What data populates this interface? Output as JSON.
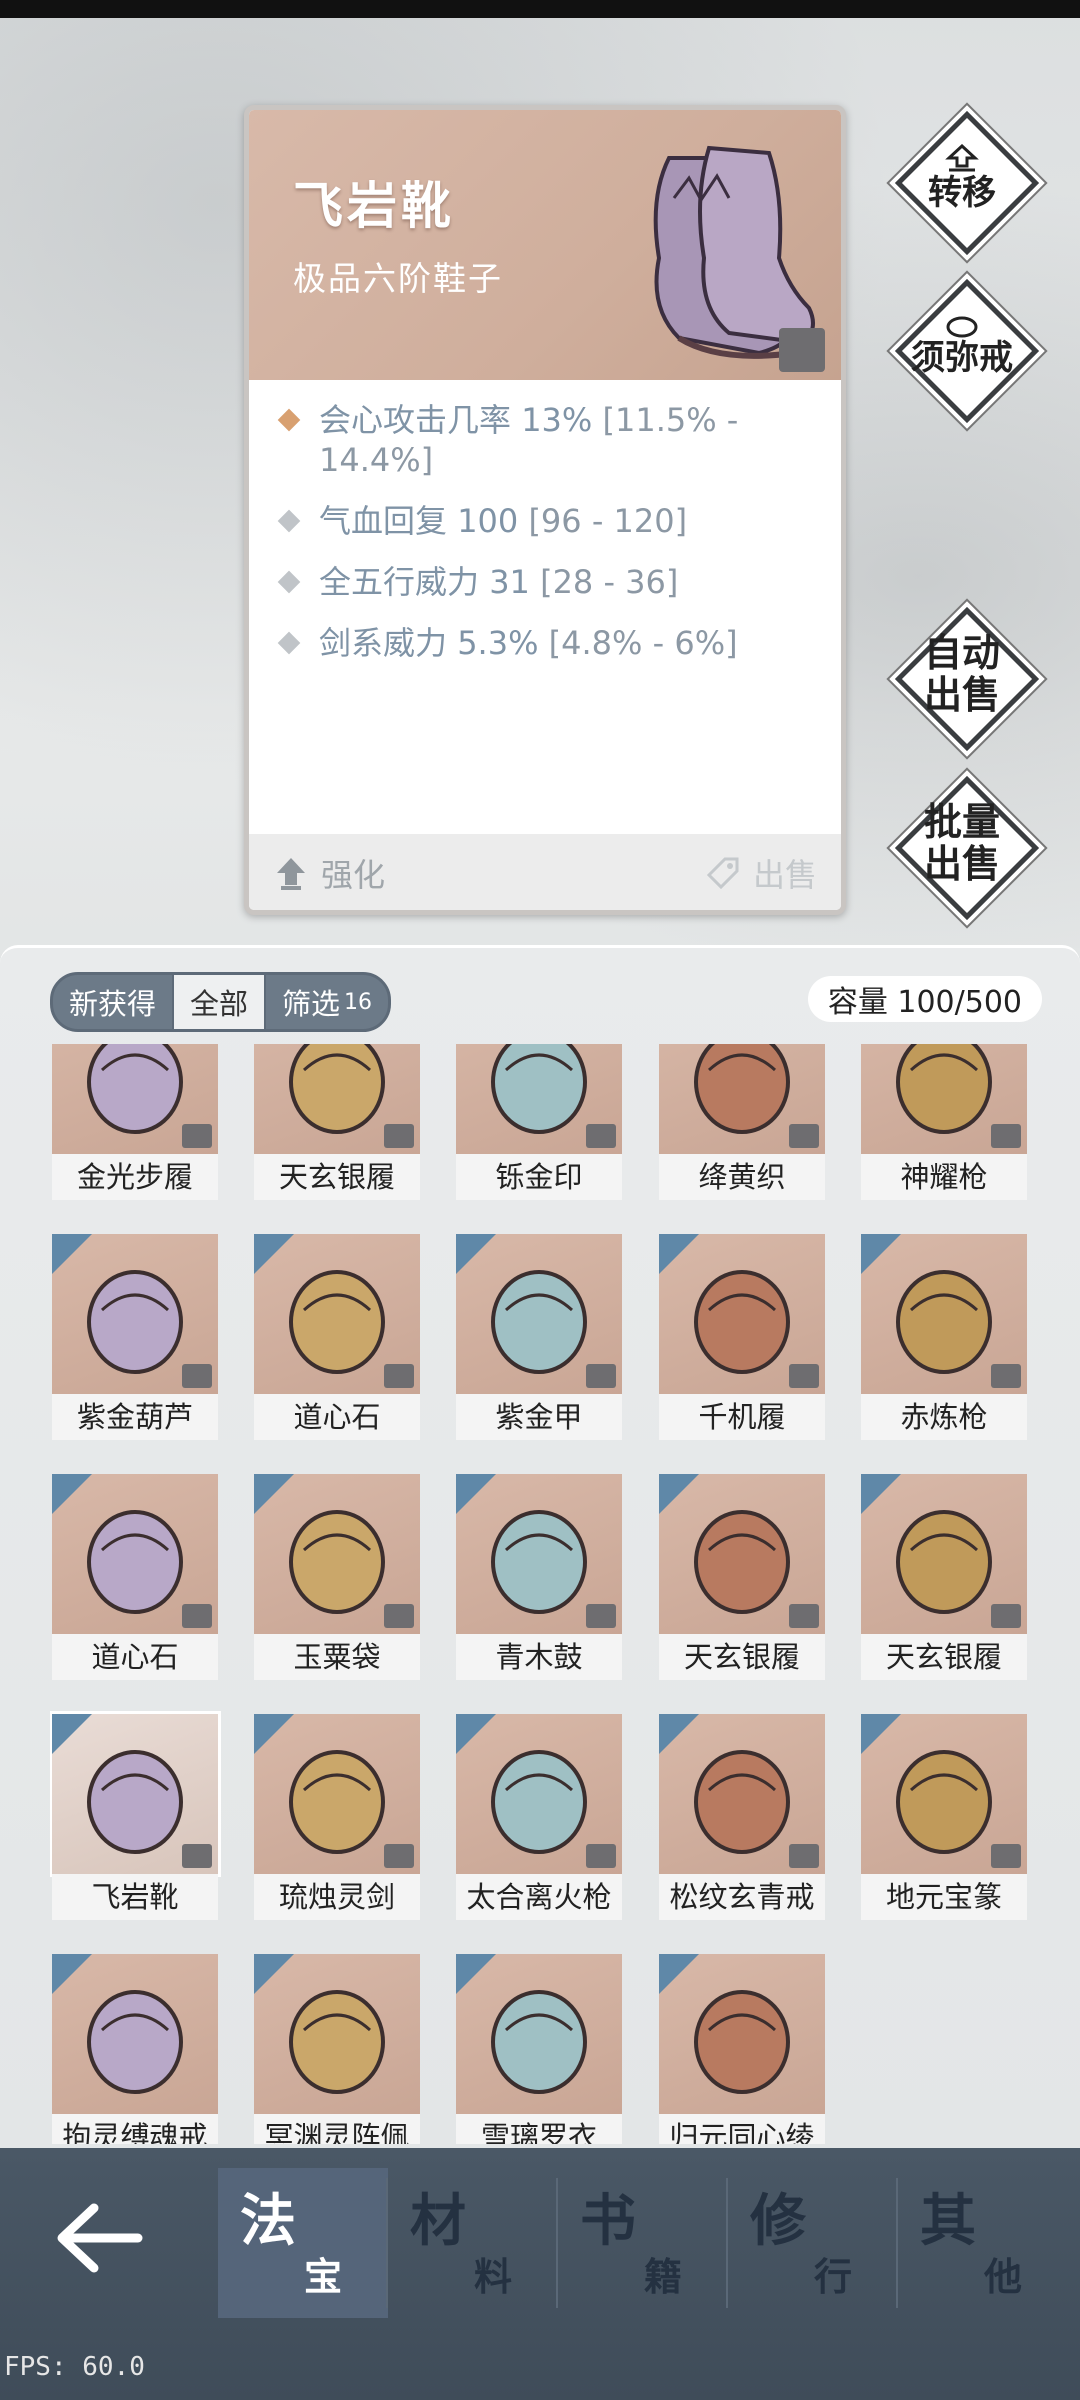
{
  "item": {
    "name": "飞岩靴",
    "grade": "极品六阶鞋子",
    "stats": [
      {
        "name": "会心攻击几率",
        "value": "13%",
        "range": "[11.5% - 14.4%]"
      },
      {
        "name": "气血回复",
        "value": "100",
        "range": "[96 - 120]"
      },
      {
        "name": "全五行威力",
        "value": "31",
        "range": "[28 - 36]"
      },
      {
        "name": "剑系威力",
        "value": "5.3%",
        "range": "[4.8% - 6%]"
      }
    ],
    "enhance_label": "强化",
    "sell_label": "出售"
  },
  "side_buttons": {
    "transfer": "转移",
    "ring": "须弥戒",
    "auto_sell_1": "自动",
    "auto_sell_2": "出售",
    "batch_sell_1": "批量",
    "batch_sell_2": "出售"
  },
  "inventory": {
    "tabs": [
      {
        "label": "新获得"
      },
      {
        "label": "全部"
      },
      {
        "label": "筛选",
        "badge": "16"
      }
    ],
    "capacity": "容量 100/500",
    "items": [
      "金光步履",
      "天玄银履",
      "铄金印",
      "绛黄织",
      "神耀枪",
      "紫金葫芦",
      "道心石",
      "紫金甲",
      "千机履",
      "赤炼枪",
      "道心石",
      "玉粟袋",
      "青木鼓",
      "天玄银履",
      "天玄银履",
      "飞岩靴",
      "琉烛灵剑",
      "太合离火枪",
      "松纹玄青戒",
      "地元宝篆",
      "拘灵缚魂戒",
      "冥渊灵阵佩",
      "雪璃罗衣",
      "归元同心绫"
    ]
  },
  "nav": {
    "tabs": [
      {
        "big": "法",
        "small": "宝"
      },
      {
        "big": "材",
        "small": "料"
      },
      {
        "big": "书",
        "small": "籍"
      },
      {
        "big": "修",
        "small": "行"
      },
      {
        "big": "其",
        "small": "他"
      }
    ]
  },
  "fps": "FPS: 60.0",
  "colors": {
    "accent": "#7f93a6",
    "card_header": "#d4b3a2",
    "nav": "#465463"
  }
}
